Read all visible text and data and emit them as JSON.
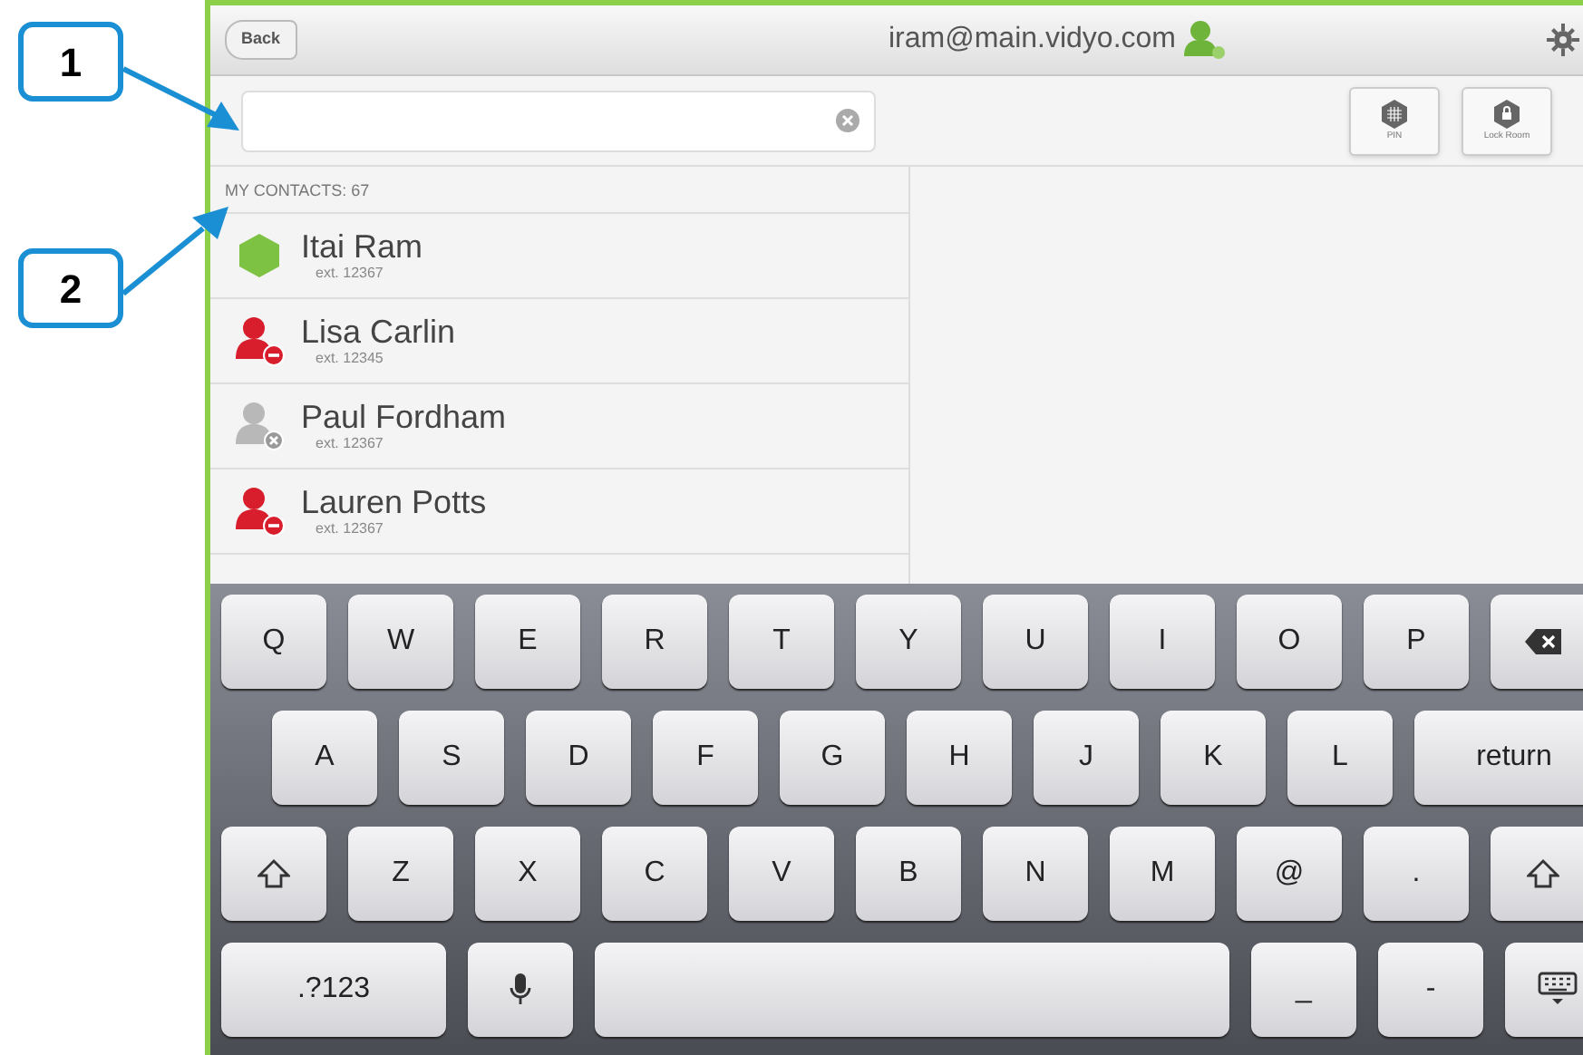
{
  "callouts": [
    {
      "label": "1"
    },
    {
      "label": "2"
    }
  ],
  "header": {
    "back": "Back",
    "title": "iram@main.vidyo.com"
  },
  "toolbar": [
    {
      "kind": "pin",
      "label": "PIN"
    },
    {
      "kind": "lock",
      "label": "Lock Room"
    }
  ],
  "contacts_header": "MY CONTACTS: 67",
  "contacts": [
    {
      "name": "Itai Ram",
      "ext": "ext. 12367",
      "kind": "online"
    },
    {
      "name": "Lisa Carlin",
      "ext": "ext. 12345",
      "kind": "busy"
    },
    {
      "name": "Paul Fordham",
      "ext": "ext. 12367",
      "kind": "offline"
    },
    {
      "name": "Lauren Potts",
      "ext": "ext. 12367",
      "kind": "busy"
    }
  ],
  "keyboard": [
    [
      {
        "kind": "char",
        "label": "Q"
      },
      {
        "kind": "char",
        "label": "W"
      },
      {
        "kind": "char",
        "label": "E"
      },
      {
        "kind": "char",
        "label": "R"
      },
      {
        "kind": "char",
        "label": "T"
      },
      {
        "kind": "char",
        "label": "Y"
      },
      {
        "kind": "char",
        "label": "U"
      },
      {
        "kind": "char",
        "label": "I"
      },
      {
        "kind": "char",
        "label": "O"
      },
      {
        "kind": "char",
        "label": "P"
      },
      {
        "kind": "backspace"
      }
    ],
    [
      {
        "kind": "char",
        "label": "A"
      },
      {
        "kind": "char",
        "label": "S"
      },
      {
        "kind": "char",
        "label": "D"
      },
      {
        "kind": "char",
        "label": "F"
      },
      {
        "kind": "char",
        "label": "G"
      },
      {
        "kind": "char",
        "label": "H"
      },
      {
        "kind": "char",
        "label": "J"
      },
      {
        "kind": "char",
        "label": "K"
      },
      {
        "kind": "char",
        "label": "L"
      },
      {
        "kind": "return",
        "label": "return"
      }
    ],
    [
      {
        "kind": "shift"
      },
      {
        "kind": "char",
        "label": "Z"
      },
      {
        "kind": "char",
        "label": "X"
      },
      {
        "kind": "char",
        "label": "C"
      },
      {
        "kind": "char",
        "label": "V"
      },
      {
        "kind": "char",
        "label": "B"
      },
      {
        "kind": "char",
        "label": "N"
      },
      {
        "kind": "char",
        "label": "M"
      },
      {
        "kind": "char",
        "label": "@"
      },
      {
        "kind": "char",
        "label": "."
      },
      {
        "kind": "shift"
      }
    ],
    [
      {
        "kind": "numbers",
        "label": ".?123"
      },
      {
        "kind": "mic"
      },
      {
        "kind": "space"
      },
      {
        "kind": "char",
        "label": "_"
      },
      {
        "kind": "char",
        "label": "-"
      },
      {
        "kind": "hide"
      }
    ]
  ]
}
